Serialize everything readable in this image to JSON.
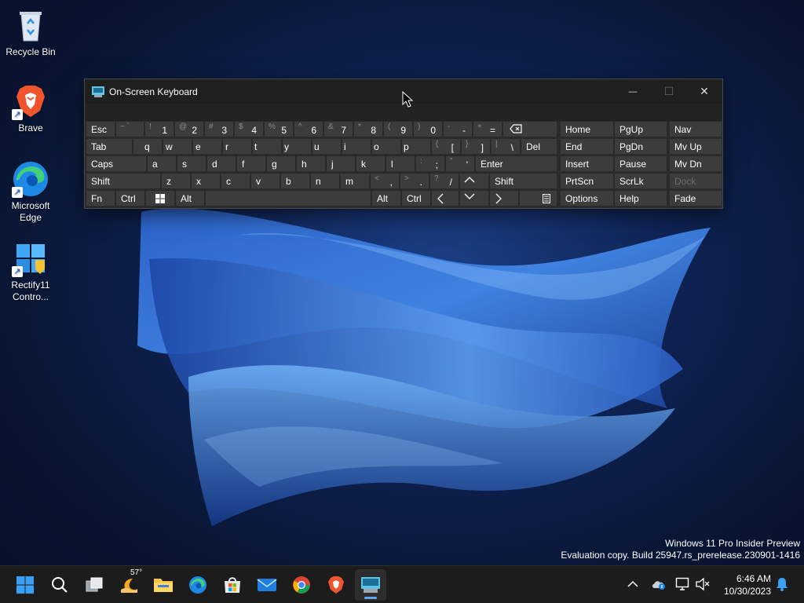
{
  "desktop": {
    "icons": [
      {
        "label": "Recycle Bin",
        "icon": "recycle-bin-icon"
      },
      {
        "label": "Brave",
        "icon": "brave-icon"
      },
      {
        "label": "Microsoft Edge",
        "icon": "edge-icon"
      },
      {
        "label": "Rectify11 Contro...",
        "icon": "rectify11-icon"
      }
    ]
  },
  "osk": {
    "title": "On-Screen Keyboard",
    "controls": {
      "minimize": "—",
      "maximize": "☐",
      "close": "✕"
    },
    "row1": [
      "Esc"
    ],
    "numbers": [
      {
        "sec": "~ `",
        "pri": ""
      },
      {
        "sec": "!",
        "pri": "1"
      },
      {
        "sec": "@",
        "pri": "2"
      },
      {
        "sec": "#",
        "pri": "3"
      },
      {
        "sec": "$",
        "pri": "4"
      },
      {
        "sec": "%",
        "pri": "5"
      },
      {
        "sec": "^",
        "pri": "6"
      },
      {
        "sec": "&",
        "pri": "7"
      },
      {
        "sec": "*",
        "pri": "8"
      },
      {
        "sec": "(",
        "pri": "9"
      },
      {
        "sec": ")",
        "pri": "0"
      },
      {
        "sec": "-",
        "pri": "-"
      },
      {
        "sec": "+",
        "pri": "="
      }
    ],
    "row2": {
      "tab": "Tab",
      "letters": [
        "q",
        "w",
        "e",
        "r",
        "t",
        "y",
        "u",
        "i",
        "o",
        "p"
      ],
      "brackets": [
        {
          "sec": "{",
          "pri": "["
        },
        {
          "sec": "}",
          "pri": "]"
        },
        {
          "sec": "|",
          "pri": "\\"
        }
      ],
      "del": "Del"
    },
    "row3": {
      "caps": "Caps",
      "letters": [
        "a",
        "s",
        "d",
        "f",
        "g",
        "h",
        "j",
        "k",
        "l"
      ],
      "punct": [
        {
          "sec": ":",
          "pri": ";"
        },
        {
          "sec": "\"",
          "pri": "'"
        }
      ],
      "enter": "Enter"
    },
    "row4": {
      "shift": "Shift",
      "letters": [
        "z",
        "x",
        "c",
        "v",
        "b",
        "n",
        "m"
      ],
      "punct": [
        {
          "sec": "<",
          "pri": ","
        },
        {
          "sec": ">",
          "pri": "."
        },
        {
          "sec": "?",
          "pri": "/"
        }
      ],
      "shift_right": "Shift"
    },
    "row5": {
      "fn": "Fn",
      "ctrl": "Ctrl",
      "alt": "Alt",
      "alt_right": "Alt",
      "ctrl_right": "Ctrl"
    },
    "nav": [
      [
        "Home",
        "PgUp",
        "Nav"
      ],
      [
        "End",
        "PgDn",
        "Mv Up"
      ],
      [
        "Insert",
        "Pause",
        "Mv Dn"
      ],
      [
        "PrtScn",
        "ScrLk",
        "Dock"
      ],
      [
        "Options",
        "Help",
        "Fade"
      ]
    ]
  },
  "watermark": {
    "line1": "Windows 11 Pro Insider Preview",
    "line2": "Evaluation copy. Build 25947.rs_prerelease.230901-1416"
  },
  "taskbar": {
    "weather_temp": "57°",
    "time": "6:46 AM",
    "date": "10/30/2023"
  }
}
